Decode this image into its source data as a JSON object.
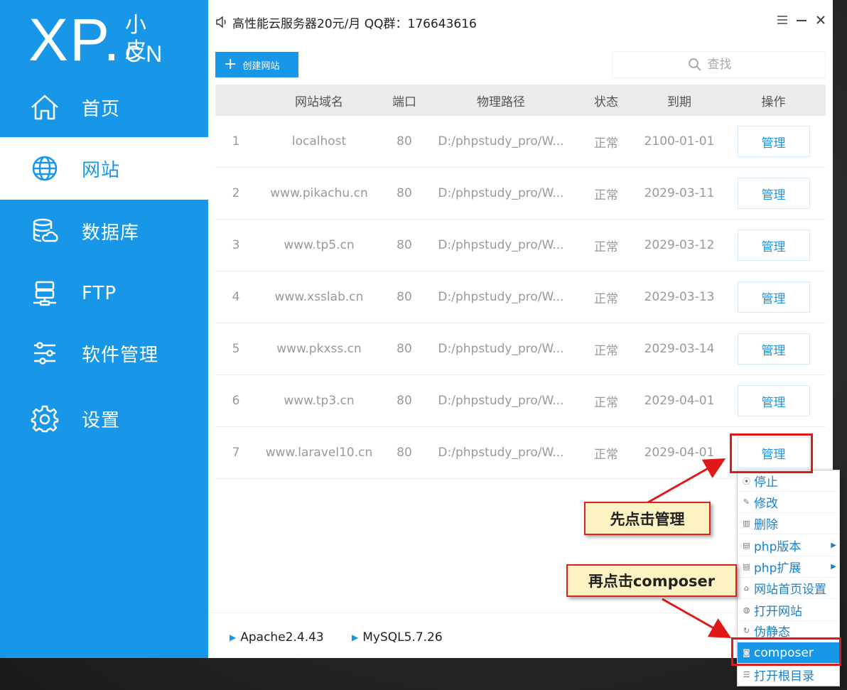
{
  "logo": {
    "main": "XP.",
    "cn_top": "小皮",
    "cn_bottom": "CN"
  },
  "sidebar": {
    "items": [
      {
        "label": "首页",
        "icon": "home-icon"
      },
      {
        "label": "网站",
        "icon": "globe-icon",
        "active": true
      },
      {
        "label": "数据库",
        "icon": "database-icon"
      },
      {
        "label": "FTP",
        "icon": "ftp-server-icon"
      },
      {
        "label": "软件管理",
        "icon": "sliders-icon"
      },
      {
        "label": "设置",
        "icon": "gear-icon"
      }
    ]
  },
  "titlebar": {
    "marquee": "高性能云服务器20元/月  QQ群：176643616"
  },
  "toolbar": {
    "create_label": "创建网站",
    "search_placeholder": "查找"
  },
  "table": {
    "headers": [
      "网站域名",
      "端口",
      "物理路径",
      "状态",
      "到期",
      "操作"
    ],
    "rows": [
      {
        "num": "1",
        "domain": "localhost",
        "port": "80",
        "path": "D:/phpstudy_pro/W...",
        "status": "正常",
        "expire": "2100-01-01",
        "op": "管理"
      },
      {
        "num": "2",
        "domain": "www.pikachu.cn",
        "port": "80",
        "path": "D:/phpstudy_pro/W...",
        "status": "正常",
        "expire": "2029-03-11",
        "op": "管理"
      },
      {
        "num": "3",
        "domain": "www.tp5.cn",
        "port": "80",
        "path": "D:/phpstudy_pro/W...",
        "status": "正常",
        "expire": "2029-03-12",
        "op": "管理"
      },
      {
        "num": "4",
        "domain": "www.xsslab.cn",
        "port": "80",
        "path": "D:/phpstudy_pro/W...",
        "status": "正常",
        "expire": "2029-03-13",
        "op": "管理"
      },
      {
        "num": "5",
        "domain": "www.pkxss.cn",
        "port": "80",
        "path": "D:/phpstudy_pro/W...",
        "status": "正常",
        "expire": "2029-03-14",
        "op": "管理"
      },
      {
        "num": "6",
        "domain": "www.tp3.cn",
        "port": "80",
        "path": "D:/phpstudy_pro/W...",
        "status": "正常",
        "expire": "2029-04-01",
        "op": "管理"
      },
      {
        "num": "7",
        "domain": "www.laravel10.cn",
        "port": "80",
        "path": "D:/phpstudy_pro/W...",
        "status": "正常",
        "expire": "2029-04-01",
        "op": "管理"
      }
    ]
  },
  "footer": {
    "services": [
      "Apache2.4.43",
      "MySQL5.7.26"
    ]
  },
  "context_menu": {
    "items": [
      {
        "label": "停止",
        "icon": "stop-icon"
      },
      {
        "label": "修改",
        "icon": "pencil-icon"
      },
      {
        "label": "删除",
        "icon": "trash-icon"
      },
      {
        "label": "php版本",
        "icon": "php-icon",
        "submenu": true
      },
      {
        "label": "php扩展",
        "icon": "php-ext-icon",
        "submenu": true
      },
      {
        "label": "网站首页设置",
        "icon": "home-small-icon"
      },
      {
        "label": "打开网站",
        "icon": "globe-small-icon"
      },
      {
        "label": "伪静态",
        "icon": "refresh-icon"
      },
      {
        "label": "composer",
        "icon": "composer-icon",
        "highlighted": true
      },
      {
        "label": "打开根目录",
        "icon": "folder-list-icon"
      }
    ]
  },
  "annotations": {
    "step1": "先点击管理",
    "step2": "再点击composer"
  },
  "colors": {
    "primary": "#1896e8",
    "annotation_red": "#e01818",
    "callout_bg": "#fdf3c2"
  }
}
